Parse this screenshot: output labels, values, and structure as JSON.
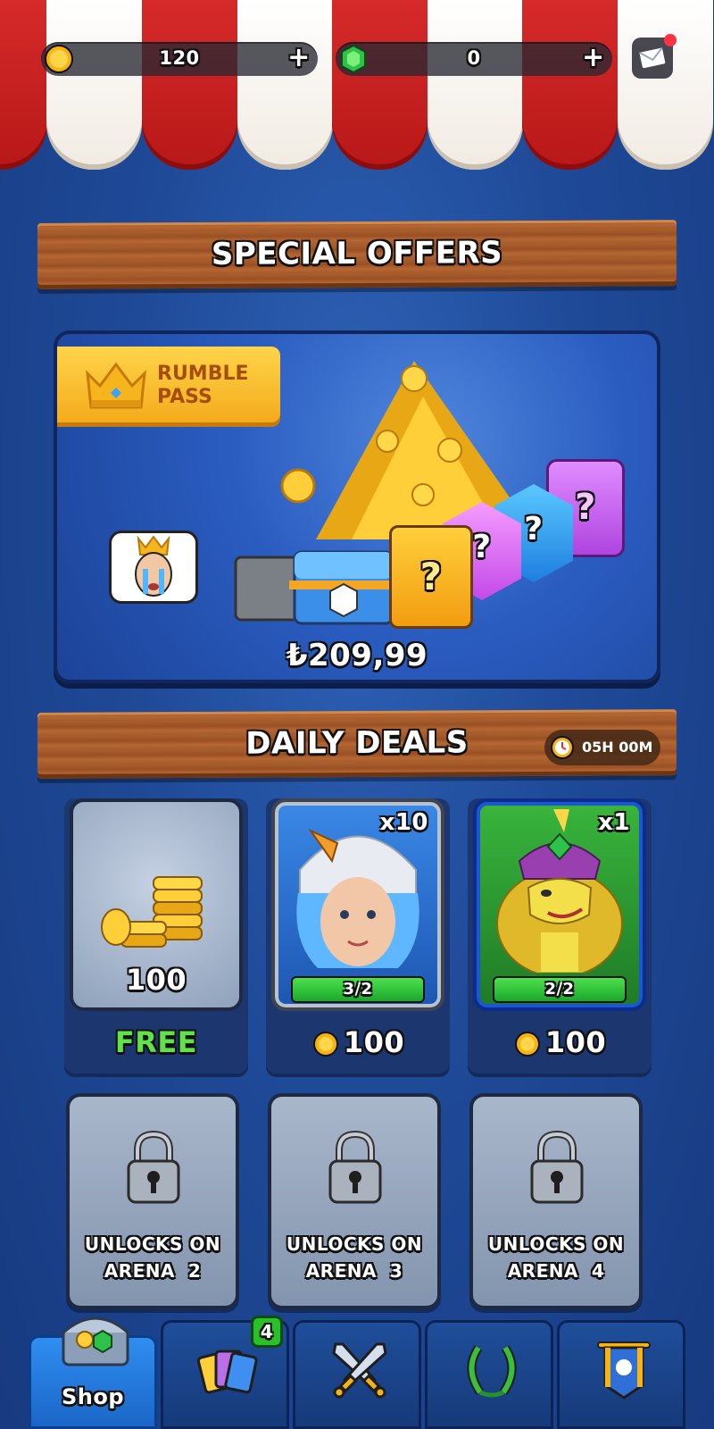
{
  "top_bar": {
    "gold": {
      "icon": "gold-coin-icon",
      "value": "120",
      "plus": "+"
    },
    "gems": {
      "icon": "gem-icon",
      "value": "0",
      "plus": "+"
    },
    "mail": {
      "icon": "mail-icon",
      "has_notification": true
    }
  },
  "special_offers": {
    "title": "SPECIAL OFFERS",
    "offer": {
      "tag_label": "RUMBLE PASS",
      "price": "₺209,99"
    }
  },
  "daily_deals": {
    "title": "DAILY DEALS",
    "timer": "05H 00M",
    "deals": [
      {
        "type": "gold",
        "amount": "100",
        "price": "FREE"
      },
      {
        "type": "card",
        "quantity": "x10",
        "progress_label": "3/2",
        "progress": 1.0,
        "price": "100",
        "rarity_color": "#2f7ee0"
      },
      {
        "type": "card",
        "quantity": "x1",
        "progress_label": "2/2",
        "progress": 1.0,
        "price": "100",
        "rarity_color": "#2ea83a"
      }
    ],
    "locked": [
      {
        "line1": "UNLOCKS ON",
        "line2": "ARENA  2"
      },
      {
        "line1": "UNLOCKS ON",
        "line2": "ARENA  3"
      },
      {
        "line1": "UNLOCKS ON",
        "line2": "ARENA  4"
      }
    ]
  },
  "nav": {
    "tabs": [
      {
        "label": "Shop",
        "icon": "shop-chest-icon",
        "active": true
      },
      {
        "label": "",
        "icon": "cards-icon",
        "badge": "4"
      },
      {
        "label": "",
        "icon": "battle-swords-icon"
      },
      {
        "label": "",
        "icon": "laurel-wreath-icon"
      },
      {
        "label": "",
        "icon": "clan-banner-icon"
      }
    ]
  },
  "colors": {
    "awning_red": "#d62a2a",
    "awning_white": "#ffffff",
    "background_blue": "#2f63b8",
    "wood": "#a45a2a",
    "free_green": "#62e24a",
    "progress_green": "#3fd33f"
  }
}
